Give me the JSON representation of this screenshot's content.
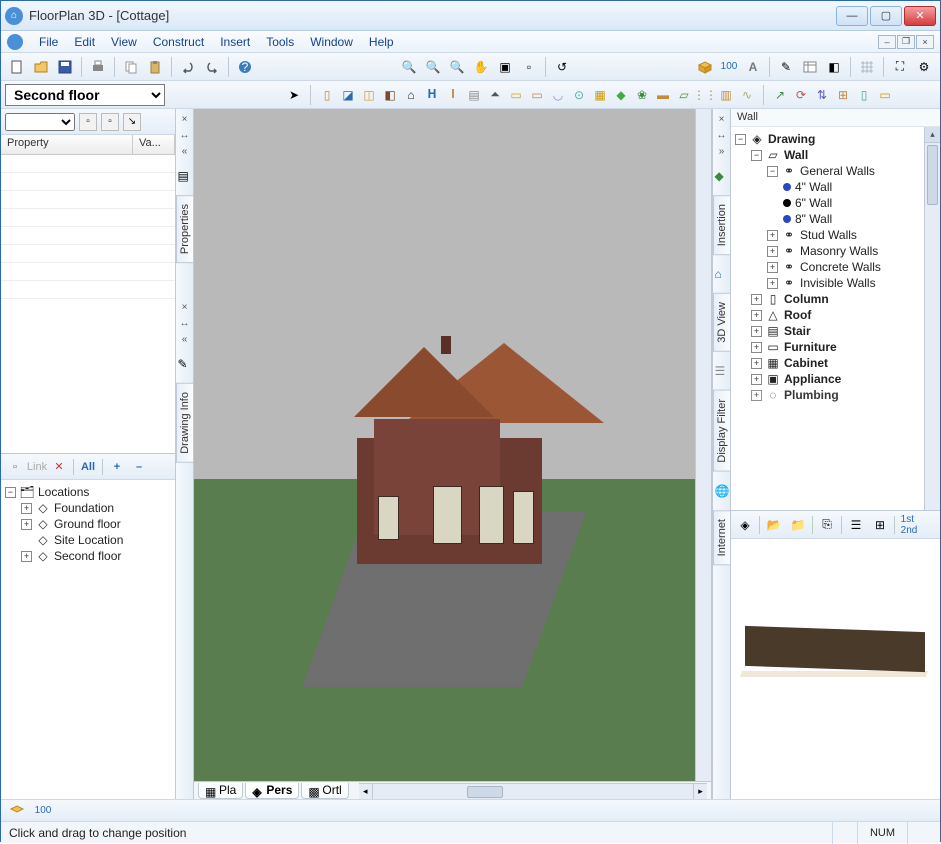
{
  "title": "FloorPlan 3D - [Cottage]",
  "menus": {
    "file": "File",
    "edit": "Edit",
    "view": "View",
    "construct": "Construct",
    "insert": "Insert",
    "tools": "Tools",
    "window": "Window",
    "help": "Help"
  },
  "floor_selector": {
    "value": "Second floor"
  },
  "properties": {
    "col_property": "Property",
    "col_value": "Va..."
  },
  "loc_toolbar": {
    "link": "Link",
    "all": "All",
    "plus": "+",
    "minus": "–"
  },
  "locations": {
    "root": "Locations",
    "children": [
      {
        "label": "Foundation"
      },
      {
        "label": "Ground floor"
      },
      {
        "label": "Site Location"
      },
      {
        "label": "Second floor"
      }
    ]
  },
  "left_tabs": {
    "properties": "Properties",
    "drawing_info": "Drawing Info"
  },
  "right_tabs": {
    "insertion": "Insertion",
    "3d_view": "3D View",
    "display_filter": "Display Filter",
    "internet": "Internet"
  },
  "right_panel_title": "Wall",
  "drawing_tree": {
    "root": "Drawing",
    "wall": "Wall",
    "general_walls": "General Walls",
    "wall_4": "4\" Wall",
    "wall_6": "6\" Wall",
    "wall_8": "8\" Wall",
    "stud_walls": "Stud Walls",
    "masonry_walls": "Masonry Walls",
    "concrete_walls": "Concrete Walls",
    "invisible_walls": "Invisible Walls",
    "column": "Column",
    "roof": "Roof",
    "stair": "Stair",
    "furniture": "Furniture",
    "cabinet": "Cabinet",
    "appliance": "Appliance",
    "plumbing": "Plumbing"
  },
  "viewport_tabs": {
    "plan": "Pla",
    "perspective": "Pers",
    "ortho": "Ortl"
  },
  "status": {
    "text": "Click and drag to change position",
    "num": "NUM"
  }
}
